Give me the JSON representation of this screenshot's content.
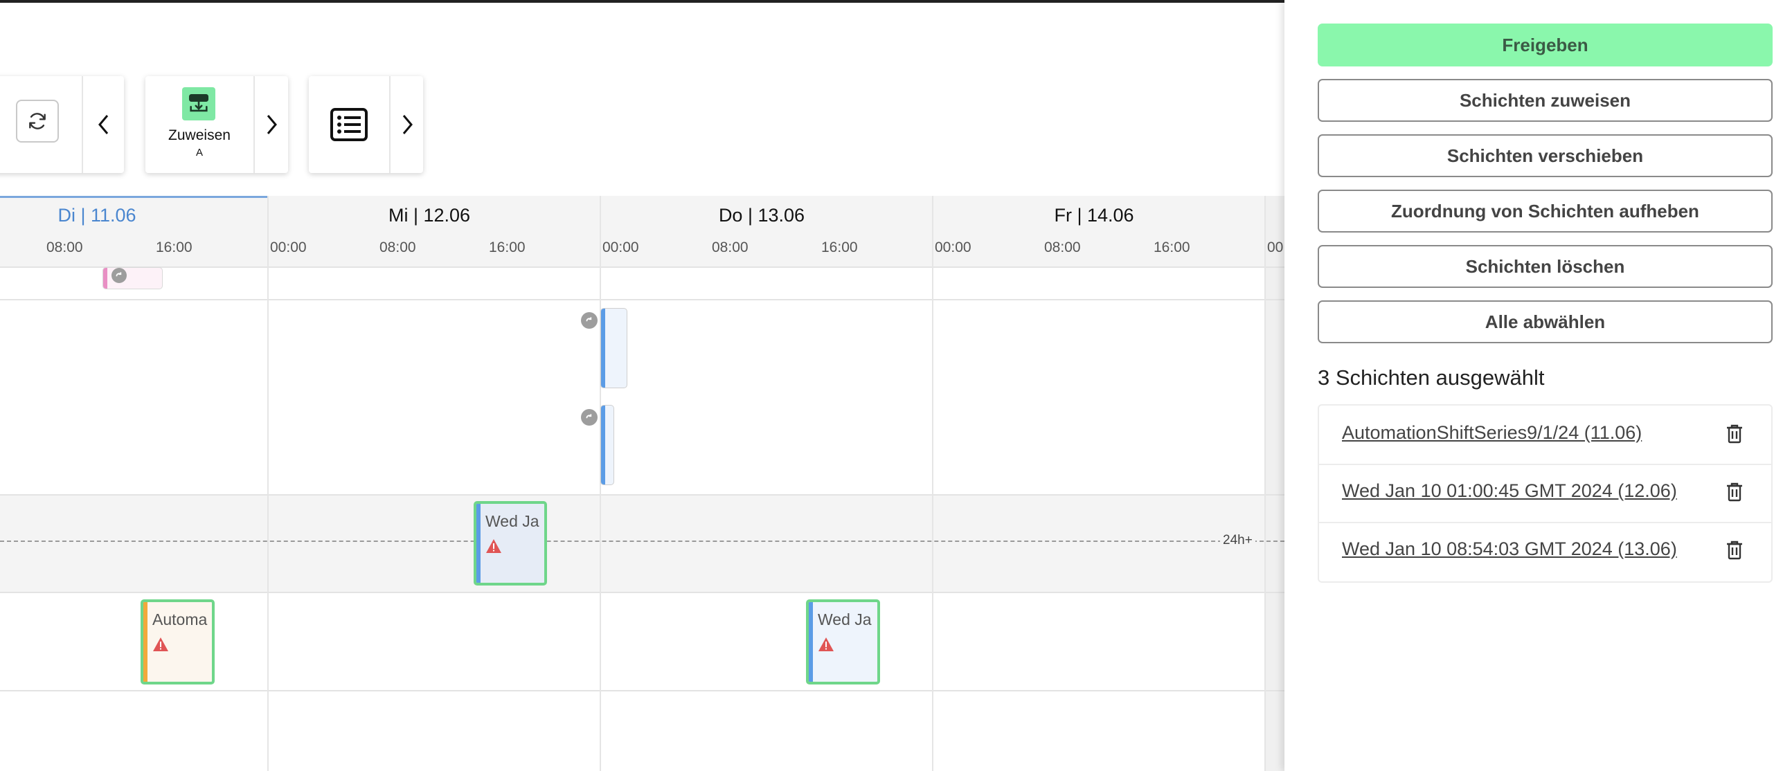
{
  "toolbar": {
    "assign_label": "Zuweisen",
    "assign_sub": "A",
    "icons": [
      "refresh-icon",
      "chevron-left-icon",
      "assign-icon",
      "chevron-right-icon",
      "list-icon",
      "chevron-right-icon"
    ]
  },
  "calendar": {
    "days": [
      {
        "label": "Di | 11.06",
        "current": true,
        "hours": [
          "08:00",
          "16:00"
        ]
      },
      {
        "label": "Mi | 12.06",
        "current": false,
        "hours": [
          "00:00",
          "08:00",
          "16:00"
        ]
      },
      {
        "label": "Do | 13.06",
        "current": false,
        "hours": [
          "00:00",
          "08:00",
          "16:00"
        ]
      },
      {
        "label": "Fr | 14.06",
        "current": false,
        "hours": [
          "00:00",
          "08:00",
          "16:00"
        ]
      }
    ],
    "partial_hour_label": "00",
    "overtime_tag": "24h+",
    "shifts": [
      {
        "label": "Wed Ja",
        "warning": true
      },
      {
        "label": "Automa",
        "warning": true
      },
      {
        "label": "Wed Ja",
        "warning": true
      }
    ],
    "colors": {
      "current_day": "#4a86cf",
      "shift_blue": "#5b9ce6",
      "shift_orange": "#f2a93b",
      "shift_pink": "#e98fc4",
      "selected_border": "#6fd68a",
      "warning": "#e05555"
    }
  },
  "panel": {
    "buttons": {
      "release": "Freigeben",
      "assign": "Schichten zuweisen",
      "move": "Schichten verschieben",
      "unassign": "Zuordnung von Schichten aufheben",
      "delete": "Schichten löschen",
      "deselect": "Alle abwählen"
    },
    "selected_title": "3 Schichten ausgewählt",
    "selected": [
      {
        "label": "AutomationShiftSeries9/1/24 (11.06)"
      },
      {
        "label": "Wed Jan 10 01:00:45 GMT 2024 (12.06)"
      },
      {
        "label": "Wed Jan 10 08:54:03 GMT 2024 (13.06)"
      }
    ],
    "colors": {
      "primary": "#8af7ac"
    }
  }
}
